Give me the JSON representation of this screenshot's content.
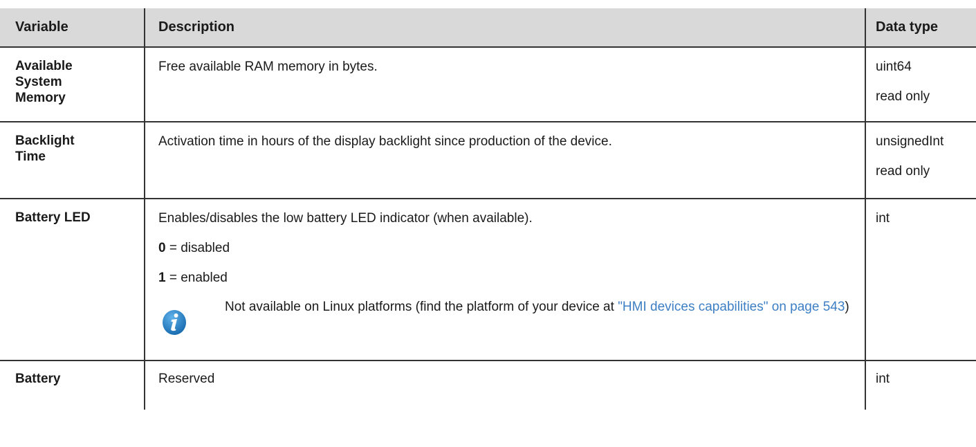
{
  "table": {
    "headers": {
      "variable": "Variable",
      "description": "Description",
      "data_type": "Data type"
    },
    "rows": [
      {
        "name_lines": [
          "Available",
          "System",
          "Memory"
        ],
        "description": "Free available RAM memory in bytes.",
        "type": "uint64",
        "access": "read only"
      },
      {
        "name_lines": [
          "Backlight",
          "Time"
        ],
        "description": "Activation time in hours of the display backlight since production of the device.",
        "type": "unsignedInt",
        "access": "read only"
      },
      {
        "name_lines": [
          "Battery LED"
        ],
        "description": "Enables/disables the low battery LED indicator (when available).",
        "options": [
          {
            "value": "0",
            "label": " = disabled"
          },
          {
            "value": "1",
            "label": " = enabled"
          }
        ],
        "note": {
          "icon": "info-icon",
          "text_before": "Not available on Linux platforms (find the platform of your device at ",
          "link_text": "\"HMI devices capabilities\" on page 543",
          "text_after": ")"
        },
        "type": "int"
      },
      {
        "name_lines": [
          "Battery"
        ],
        "description": "Reserved",
        "type": "int"
      }
    ]
  },
  "colors": {
    "header_bg": "#d9d9d9",
    "border": "#333333",
    "link": "#3d7fc4",
    "icon_blue": "#1e7fc6"
  }
}
